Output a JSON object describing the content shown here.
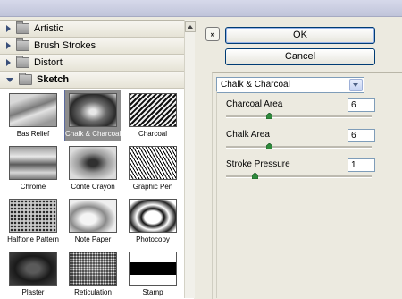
{
  "browser": {
    "categories": [
      {
        "label": "Artistic",
        "expanded": false
      },
      {
        "label": "Brush Strokes",
        "expanded": false
      },
      {
        "label": "Distort",
        "expanded": false
      },
      {
        "label": "Sketch",
        "expanded": true
      }
    ],
    "filters": [
      {
        "label": "Bas Relief",
        "selected": false
      },
      {
        "label": "Chalk & Charcoal",
        "selected": true
      },
      {
        "label": "Charcoal",
        "selected": false
      },
      {
        "label": "Chrome",
        "selected": false
      },
      {
        "label": "Conté Crayon",
        "selected": false
      },
      {
        "label": "Graphic Pen",
        "selected": false
      },
      {
        "label": "Halftone Pattern",
        "selected": false
      },
      {
        "label": "Note Paper",
        "selected": false
      },
      {
        "label": "Photocopy",
        "selected": false
      },
      {
        "label": "Plaster",
        "selected": false
      },
      {
        "label": "Reticulation",
        "selected": false
      },
      {
        "label": "Stamp",
        "selected": false
      }
    ]
  },
  "buttons": {
    "ok": "OK",
    "cancel": "Cancel",
    "collapse": "»"
  },
  "settings": {
    "filter_select": "Chalk & Charcoal",
    "params": [
      {
        "label": "Charcoal Area",
        "value": "6",
        "fraction": 0.3
      },
      {
        "label": "Chalk Area",
        "value": "6",
        "fraction": 0.3
      },
      {
        "label": "Stroke Pressure",
        "value": "1",
        "fraction": 0.2
      }
    ]
  },
  "colors": {
    "accent_border": "#003c74",
    "slider_thumb": "#2f8a3c"
  }
}
